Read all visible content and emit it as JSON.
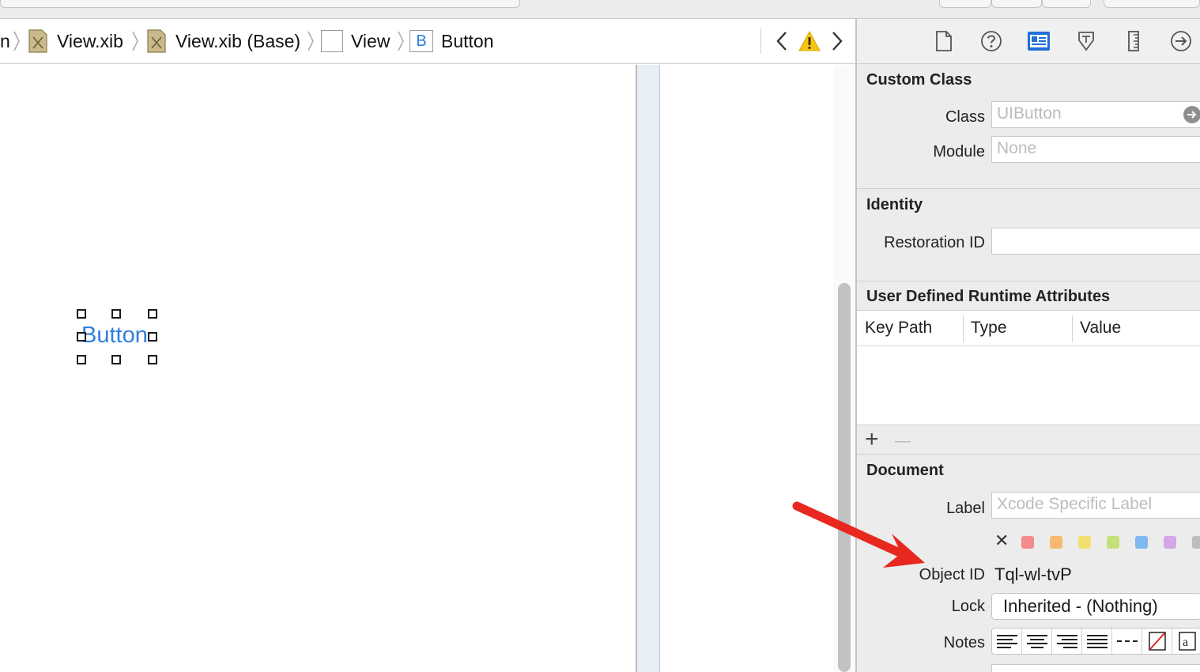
{
  "breadcrumb": {
    "items": [
      {
        "label": "n",
        "icon": "folder-partial"
      },
      {
        "label": "View.xib",
        "icon": "xib-file-icon"
      },
      {
        "label": "View.xib (Base)",
        "icon": "xib-file-icon"
      },
      {
        "label": "View",
        "icon": "view-icon"
      },
      {
        "label": "Button",
        "icon": "button-icon",
        "glyph": "B"
      }
    ]
  },
  "jumpbar_controls": {
    "back": "‹",
    "forward": "›",
    "warning": "!"
  },
  "canvas": {
    "button_title": "Button",
    "button_title_color": "#2f7fe0"
  },
  "inspector": {
    "tabs": [
      "file-inspector-icon",
      "quick-help-icon",
      "identity-inspector-icon",
      "attributes-inspector-icon",
      "size-inspector-icon",
      "connections-inspector-icon"
    ],
    "selected_tab": "identity-inspector-icon",
    "custom_class": {
      "title": "Custom Class",
      "class_label": "Class",
      "class_placeholder": "UIButton",
      "module_label": "Module",
      "module_placeholder": "None"
    },
    "identity": {
      "title": "Identity",
      "restoration_label": "Restoration ID",
      "restoration_value": ""
    },
    "runtime_attributes": {
      "title": "User Defined Runtime Attributes",
      "columns": [
        "Key Path",
        "Type",
        "Value"
      ],
      "add": "+",
      "remove": "—"
    },
    "document": {
      "title": "Document",
      "label_label": "Label",
      "label_placeholder": "Xcode Specific Label",
      "clear_color": "✕",
      "label_colors": [
        "#f28b8b",
        "#f5b971",
        "#f3df6e",
        "#c4e07a",
        "#7fb8ef",
        "#d4a6e8",
        "#bdbdbd"
      ],
      "object_id_label": "Object ID",
      "object_id_value": "Tql-wl-tvP",
      "lock_label": "Lock",
      "lock_value": "Inherited - (Nothing)",
      "notes_label": "Notes"
    }
  },
  "annotation": {
    "arrow_color": "#e8281e"
  }
}
